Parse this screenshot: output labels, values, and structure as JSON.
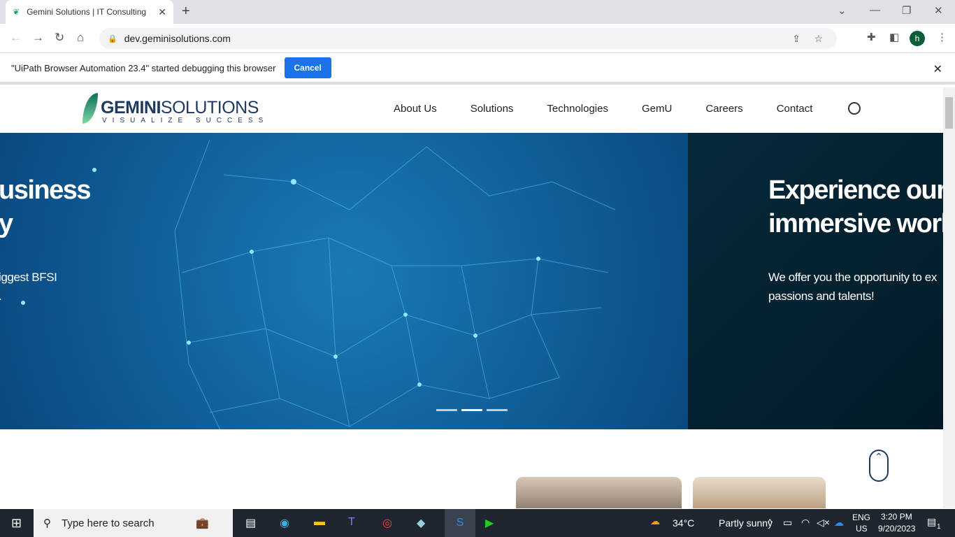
{
  "browser": {
    "tab_title": "Gemini Solutions | IT Consulting",
    "url": "dev.geminisolutions.com",
    "profile_initial": "h"
  },
  "debug_bar": {
    "message": "\"UiPath Browser Automation 23.4\" started debugging this browser",
    "cancel_label": "Cancel"
  },
  "site": {
    "logo": {
      "name_bold": "GEMINI",
      "name_rest": "SOLUTIONS",
      "tagline": "VISUALIZE SUCCESS"
    },
    "nav": [
      "About Us",
      "Solutions",
      "Technologies",
      "GemU",
      "Careers",
      "Contact"
    ],
    "hero": {
      "slide1_heading_line1": "usiness",
      "slide1_heading_line2": "y",
      "slide1_text_line1": "iggest BFSI",
      "slide1_text_line2": ".",
      "slide2_heading_line1": "Experience our",
      "slide2_heading_line2": "immersive work",
      "slide2_text_line1": "We offer you the opportunity to ex",
      "slide2_text_line2": "passions and talents!",
      "active_slide": 2,
      "slide_count": 3
    }
  },
  "taskbar": {
    "search_placeholder": "Type here to search",
    "weather_temp": "34°C",
    "weather_text": "Partly sunny",
    "weather_badge": "1",
    "lang": "ENG",
    "region": "US",
    "time": "3:20 PM",
    "date": "9/20/2023",
    "notifications": "1"
  }
}
